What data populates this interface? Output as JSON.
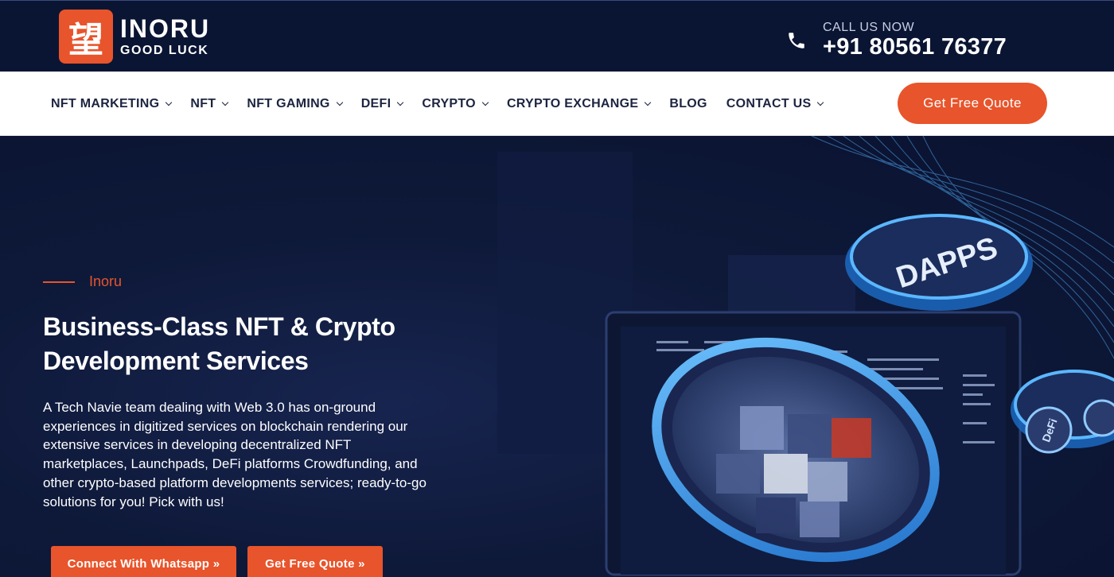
{
  "header": {
    "logo_glyph": "望",
    "logo_name": "INORU",
    "logo_tagline": "GOOD LUCK",
    "call_label": "CALL US NOW",
    "call_number": "+91 80561 76377",
    "phone_icon": "phone-icon"
  },
  "nav": {
    "items": [
      {
        "label": "NFT MARKETING",
        "has_dropdown": true
      },
      {
        "label": "NFT",
        "has_dropdown": true
      },
      {
        "label": "NFT GAMING",
        "has_dropdown": true
      },
      {
        "label": "DEFI",
        "has_dropdown": true
      },
      {
        "label": "CRYPTO",
        "has_dropdown": true
      },
      {
        "label": "CRYPTO EXCHANGE",
        "has_dropdown": true
      },
      {
        "label": "BLOG",
        "has_dropdown": false
      },
      {
        "label": "CONTACT US",
        "has_dropdown": true
      }
    ],
    "quote_button": "Get Free Quote"
  },
  "hero": {
    "eyebrow": "Inoru",
    "title": "Business-Class NFT & Crypto Development Services",
    "description": "A Tech Navie team dealing with Web 3.0 has on-ground experiences in digitized services on blockchain rendering our extensive services in developing decentralized NFT marketplaces, Launchpads, DeFi platforms Crowdfunding, and other crypto-based platform developments services; ready-to-go solutions for you! Pick with us!",
    "cta_whatsapp": "Connect With Whatsapp »",
    "cta_quote": "Get Free Quote »",
    "art_labels": {
      "dapps": "DAPPS",
      "defi": "DeFi"
    }
  },
  "colors": {
    "accent": "#e8542b",
    "navy": "#0a1533",
    "glow": "#2e8fe0"
  }
}
